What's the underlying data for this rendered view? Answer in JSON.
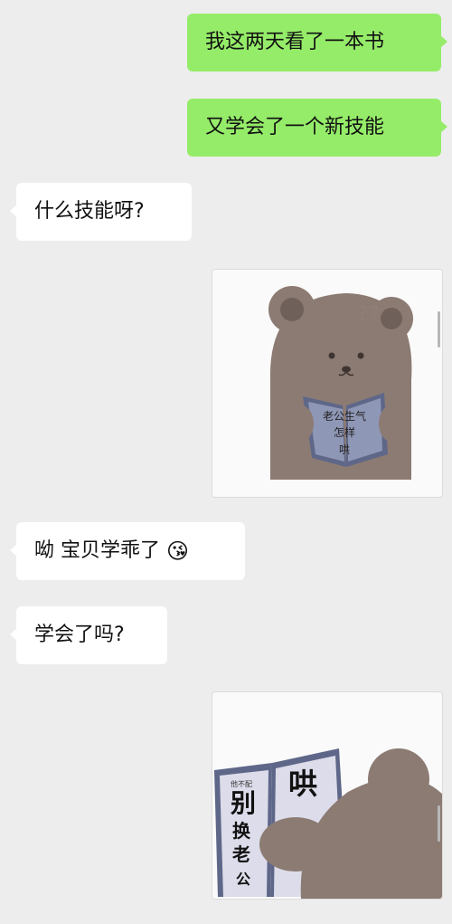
{
  "messages": [
    {
      "side": "sent",
      "text": "我这两天看了一本书"
    },
    {
      "side": "sent",
      "text": "又学会了一个新技能"
    },
    {
      "side": "recv",
      "text": "什么技能呀?"
    },
    {
      "side": "recv",
      "type": "sticker",
      "name": "bear-reading-book",
      "lines": [
        "老公生气",
        "怎样",
        "哄"
      ],
      "marks": "??"
    },
    {
      "side": "recv",
      "text": "呦 宝贝学乖了",
      "emoji": "😘"
    },
    {
      "side": "recv",
      "text": "学会了吗?"
    },
    {
      "side": "recv",
      "type": "sticker",
      "name": "bear-reading-book-back",
      "small": "他不配",
      "left_lines": [
        "别",
        "换",
        "老",
        "公"
      ],
      "right_text": "哄"
    }
  ],
  "colors": {
    "sent_bubble": "#95ec69",
    "recv_bubble": "#ffffff",
    "background": "#ededed",
    "bear": "#8c7b73",
    "book": "#5f6789"
  }
}
